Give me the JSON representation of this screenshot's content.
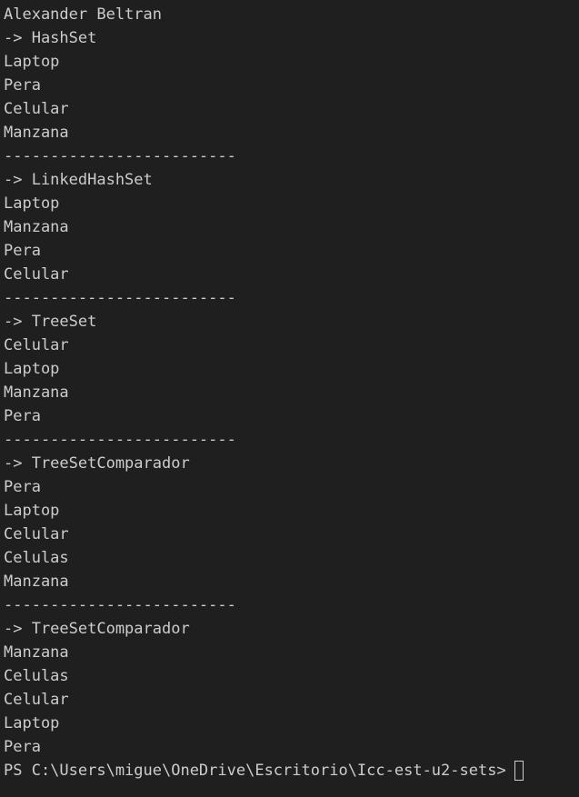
{
  "terminal": {
    "lines": [
      "Alexander Beltran",
      "-> HashSet",
      "Laptop",
      "Pera",
      "Celular",
      "Manzana",
      "-------------------------",
      "-> LinkedHashSet",
      "Laptop",
      "Manzana",
      "Pera",
      "Celular",
      "-------------------------",
      "-> TreeSet",
      "Celular",
      "Laptop",
      "Manzana",
      "Pera",
      "-------------------------",
      "-> TreeSetComparador",
      "Pera",
      "Laptop",
      "Celular",
      "Celulas",
      "Manzana",
      "-------------------------",
      "-> TreeSetComparador",
      "Manzana",
      "Celulas",
      "Celular",
      "Laptop",
      "Pera"
    ],
    "prompt": "PS C:\\Users\\migue\\OneDrive\\Escritorio\\Icc-est-u2-sets>",
    "colors": {
      "background": "#1f1f1f",
      "text": "#cccccc"
    }
  }
}
